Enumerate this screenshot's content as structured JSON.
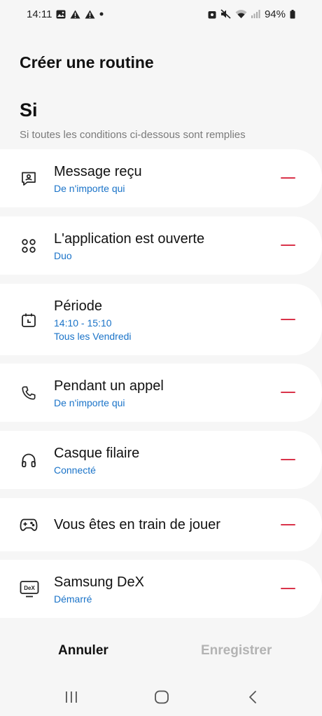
{
  "status_bar": {
    "time": "14:11",
    "battery": "94%"
  },
  "header": {
    "title": "Créer une routine"
  },
  "section": {
    "title": "Si",
    "subtitle": "Si toutes les conditions ci-dessous sont remplies"
  },
  "conditions": [
    {
      "title": "Message reçu",
      "subtitle": "De n'importe qui",
      "icon": "message-received-icon"
    },
    {
      "title": "L'application est ouverte",
      "subtitle": "Duo",
      "icon": "apps-icon"
    },
    {
      "title": "Période",
      "subtitle": "14:10 - 15:10",
      "subtitle2": "Tous les Vendredi",
      "icon": "calendar-clock-icon"
    },
    {
      "title": "Pendant un appel",
      "subtitle": "De n'importe qui",
      "icon": "phone-icon"
    },
    {
      "title": "Casque filaire",
      "subtitle": "Connecté",
      "icon": "headphones-icon"
    },
    {
      "title": "Vous êtes en train de jouer",
      "icon": "gamepad-icon"
    },
    {
      "title": "Samsung DeX",
      "subtitle": "Démarré",
      "icon": "dex-icon",
      "icon_text": "DeX"
    }
  ],
  "actions": {
    "cancel": "Annuler",
    "save": "Enregistrer"
  },
  "colors": {
    "accent": "#1a73c8",
    "remove": "#d9334a",
    "background": "#f6f6f6",
    "card": "#ffffff",
    "disabled": "#b3b3b3"
  }
}
